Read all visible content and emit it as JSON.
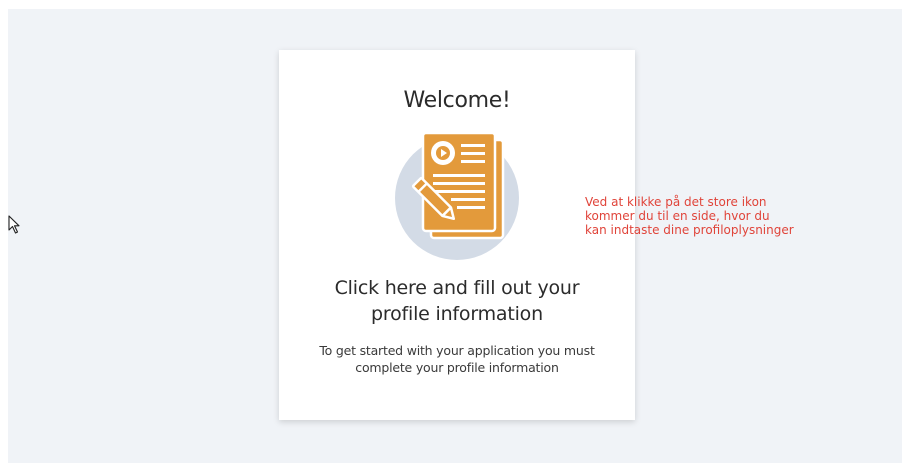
{
  "card": {
    "title": "Welcome!",
    "heading_line1": "Click here and fill out your",
    "heading_line2": "profile information",
    "description_line1": "To get started with your application you must",
    "description_line2": "complete your profile information"
  },
  "annotation": {
    "line1": "Ved at klikke på det store ikon",
    "line2": "kommer du til en side, hvor du",
    "line3": "kan indtaste dine profiloplysninger"
  },
  "colors": {
    "page_background": "#f0f3f7",
    "icon_orange": "#e39a3b",
    "icon_circle": "#d3dbe6",
    "annotation_red": "#e0443a"
  },
  "icons": {
    "cursor": "mouse-pointer-icon",
    "illustration": "profile-form-icon"
  }
}
